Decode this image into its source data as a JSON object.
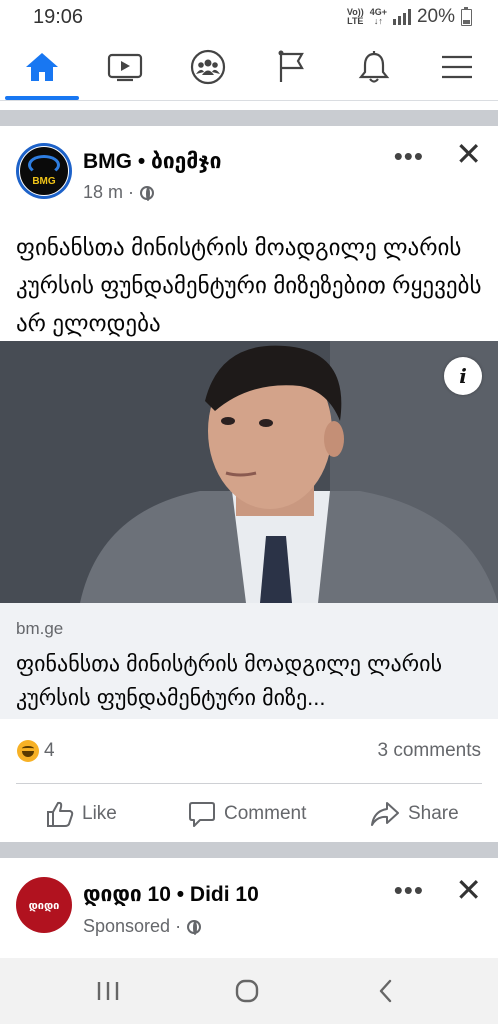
{
  "status_bar": {
    "time": "19:06",
    "volte_line1": "Vo))",
    "volte_line2": "LTE",
    "network": "4G+",
    "battery": "20%"
  },
  "nav": {
    "tabs": [
      {
        "name": "home",
        "icon": "home-icon",
        "active": true
      },
      {
        "name": "watch",
        "icon": "video-icon",
        "active": false
      },
      {
        "name": "groups",
        "icon": "groups-icon",
        "active": false
      },
      {
        "name": "pages",
        "icon": "flag-icon",
        "active": false
      },
      {
        "name": "notifications",
        "icon": "bell-icon",
        "active": false
      },
      {
        "name": "menu",
        "icon": "hamburger-icon",
        "active": false
      }
    ],
    "accent_color": "#1877f2"
  },
  "post": {
    "page_name": "BMG • ბიემჯი",
    "avatar_text": "BMG",
    "time": "18 m ·",
    "text": "ფინანსთა მინისტრის მოადგილე ლარის კურსის ფუნდამენტური მიზეზებით რყევებს არ ელოდება",
    "image_info_label": "i",
    "link_domain": "bm.ge",
    "link_title": "ფინანსთა მინისტრის მოადგილე ლარის კურსის ფუნდამენტური მიზე...",
    "reaction_count": "4",
    "comments": "3 comments",
    "actions": {
      "like": "Like",
      "comment": "Comment",
      "share": "Share"
    }
  },
  "post2": {
    "page_name": "დიდი 10 • Didi 10",
    "avatar_text": "დიდი",
    "sponsored": "Sponsored ·"
  },
  "system_nav": {
    "recents_icon": "recents-icon",
    "home_icon": "circle-home-icon",
    "back_icon": "back-chevron-icon"
  }
}
